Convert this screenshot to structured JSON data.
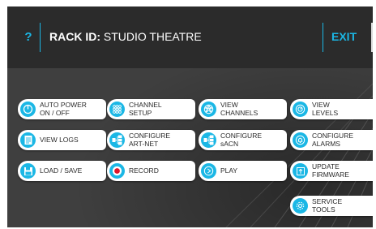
{
  "header": {
    "help_label": "?",
    "rack_id_label": "RACK ID:",
    "rack_id_value": "STUDIO THEATRE",
    "exit_label": "EXIT"
  },
  "menu": {
    "auto_power": {
      "label": "AUTO POWER\nON / OFF",
      "icon": "power-icon"
    },
    "channel_setup": {
      "label": "CHANNEL\nSETUP",
      "icon": "grid-icon"
    },
    "view_channels": {
      "label": "VIEW\nCHANNELS",
      "icon": "dial-icon"
    },
    "view_levels": {
      "label": "VIEW\nLEVELS",
      "icon": "gauge-icon"
    },
    "view_logs": {
      "label": "VIEW LOGS",
      "icon": "document-icon"
    },
    "configure_artnet": {
      "label": "CONFIGURE\nART-NET",
      "icon": "network-icon"
    },
    "configure_sacn": {
      "label": "CONFIGURE\nsACN",
      "icon": "network-icon"
    },
    "configure_alarms": {
      "label": "CONFIGURE\nALARMS",
      "icon": "bell-icon"
    },
    "load_save": {
      "label": "LOAD / SAVE",
      "icon": "floppy-icon"
    },
    "record": {
      "label": "RECORD",
      "icon": "record-icon"
    },
    "play": {
      "label": "PLAY",
      "icon": "play-icon"
    },
    "update_firmware": {
      "label": "UPDATE\nFIRMWARE",
      "icon": "upload-icon"
    },
    "service_tools": {
      "label": "SERVICE\nTOOLS",
      "icon": "gear-icon"
    }
  },
  "colors": {
    "accent": "#1bb7e5",
    "background": "#3f3f3f",
    "header": "#2b2b2b",
    "button": "#ffffff",
    "record": "#e0162b"
  }
}
